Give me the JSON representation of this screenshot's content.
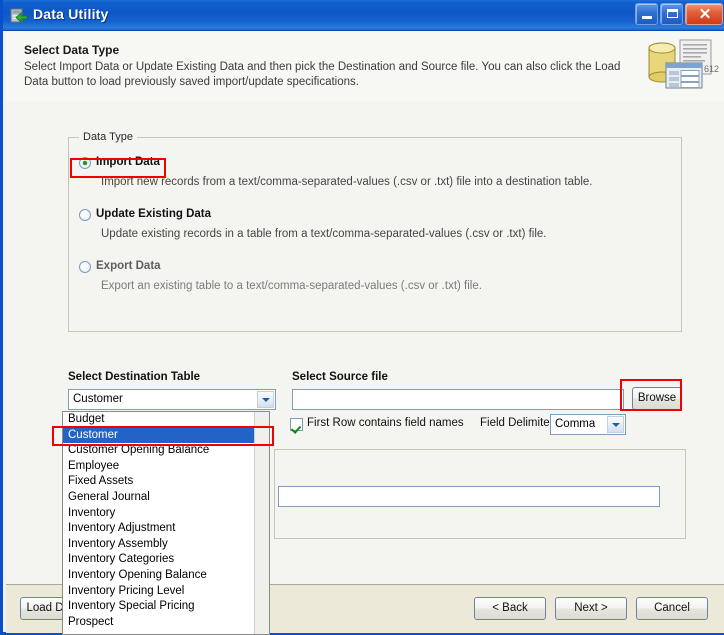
{
  "window": {
    "title": "Data Utility",
    "icon": "data-utility-icon",
    "buttons": {
      "minimize": "minimize-button",
      "maximize": "maximize-button",
      "close": "close-button",
      "close_glyph": "✕"
    }
  },
  "header": {
    "title": "Select Data Type",
    "description": "Select Import Data or Update Existing Data and then pick the Destination and Source file.  You can also click the Load Data button to load previously saved import/update specifications.",
    "icon": "database-import-icon",
    "icon_caption": "612"
  },
  "data_type_group": {
    "legend": "Data Type",
    "options": [
      {
        "label": "Import Data",
        "description": "Import new records from a text/comma-separated-values (.csv or .txt) file into a destination table.",
        "selected": true,
        "enabled": true
      },
      {
        "label": "Update Existing Data",
        "description": "Update existing records in a table from a text/comma-separated-values (.csv or .txt) file.",
        "selected": false,
        "enabled": true
      },
      {
        "label": "Export Data",
        "description": "Export an existing table to a text/comma-separated-values (.csv or .txt) file.",
        "selected": false,
        "enabled": false
      }
    ]
  },
  "destination": {
    "label": "Select Destination Table",
    "selected_value": "Customer",
    "open": true,
    "items": [
      "Budget",
      "Customer",
      "Customer Opening Balance",
      "Employee",
      "Fixed Assets",
      "General Journal",
      "Inventory",
      "Inventory Adjustment",
      "Inventory Assembly",
      "Inventory Categories",
      "Inventory Opening Balance",
      "Inventory Pricing Level",
      "Inventory Special Pricing",
      "Prospect"
    ],
    "selected_index": 1
  },
  "source": {
    "label": "Select Source file",
    "value": "",
    "placeholder": "",
    "browse_label": "Browse",
    "first_row_label": "First Row contains field names",
    "first_row_checked": true,
    "delimiter_label": "Field Delimiter",
    "delimiter_value": "Comma"
  },
  "lower_panel": {
    "input_value": ""
  },
  "footer": {
    "load_label": "Load Data",
    "back_label": "< Back",
    "next_label": "Next >",
    "cancel_label": "Cancel"
  },
  "colors": {
    "titlebar": "#0e57c6",
    "selection": "#2263c8",
    "annotation": "#f00000",
    "bottombar": "#ece9d8",
    "radio_dot": "#1a9c1a"
  }
}
